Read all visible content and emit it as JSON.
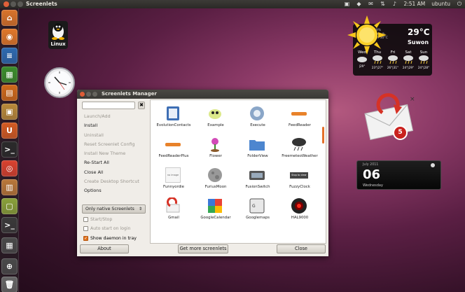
{
  "top_panel": {
    "title": "Screenlets",
    "time": "2:51 AM",
    "user": "ubuntu"
  },
  "desktop": {
    "linux_label": "Linux"
  },
  "launcher": {
    "items": [
      {
        "name": "home-folder-icon",
        "color": "#d9742b"
      },
      {
        "name": "firefox-icon",
        "color": "#e0782a"
      },
      {
        "name": "writer-icon",
        "color": "#2d6ab0"
      },
      {
        "name": "calc-icon",
        "color": "#3b8e2d"
      },
      {
        "name": "impress-icon",
        "color": "#cf6a1b"
      },
      {
        "name": "software-center-icon",
        "color": "#b98a3a"
      },
      {
        "name": "ubuntu-one-icon",
        "color": "#d45c23"
      },
      {
        "name": "terminal-icon",
        "color": "#2a2a2a"
      },
      {
        "name": "chrome-icon",
        "color": "#d9422f"
      },
      {
        "name": "archive-icon",
        "color": "#b9783a"
      },
      {
        "name": "screenlets-icon",
        "color": "#8aa23b"
      },
      {
        "name": "terminal2-icon",
        "color": "#3a3a3a"
      },
      {
        "name": "workspace-icon",
        "color": "#4a4a4a"
      },
      {
        "name": "apps-lens-icon",
        "color": "#4a4a4a"
      },
      {
        "name": "trash-icon",
        "color": "#666666"
      }
    ]
  },
  "manager": {
    "title": "Screenlets Manager",
    "clear_glyph": "✖",
    "menu": [
      {
        "label": "Launch/Add",
        "enabled": false
      },
      {
        "label": "Install",
        "enabled": true
      },
      {
        "label": "Uninstall",
        "enabled": false
      },
      {
        "label": "Reset Screenlet Config",
        "enabled": false
      },
      {
        "label": "Install New Theme",
        "enabled": false
      },
      {
        "label": "Re-Start All",
        "enabled": true
      },
      {
        "label": "Close All",
        "enabled": true
      },
      {
        "label": "Create Desktop Shortcut",
        "enabled": false
      },
      {
        "label": "Options",
        "enabled": true
      }
    ],
    "filter_value": "Only native Screenlets",
    "start_stop_label": "Start/Stop",
    "auto_start_label": "Auto start on login",
    "show_daemon_label": "Show daemon in tray",
    "show_daemon_checked": true,
    "grid_items": [
      "EvolutionContacts",
      "Example",
      "Execute",
      "FeedReader",
      "FeedReaderPlus",
      "Flower",
      "FolderView",
      "FreemeteoWeather",
      "Funnyordie",
      "FuriusMoon",
      "FusionSwitch",
      "FuzzyClock",
      "Gmail",
      "GoogleCalendar",
      "Googlemaps",
      "HAL9000"
    ],
    "funnyordie_thumb_text": "no image",
    "fuzzyclock_thumb_text": "Stop to clear",
    "about_label": "About",
    "more_label": "Get more screenlets",
    "close_label": "Close"
  },
  "weather": {
    "temp": "29°C",
    "city": "Suwon",
    "details": [
      "H 49%",
      "W 5Km/h",
      "W Ch 30°C"
    ],
    "days": [
      {
        "day": "Wed",
        "temps": "|29°"
      },
      {
        "day": "Thu",
        "temps": "23°|27°"
      },
      {
        "day": "Fri",
        "temps": "26°|31°"
      },
      {
        "day": "Sat",
        "temps": "24°|29°"
      },
      {
        "day": "Sun",
        "temps": "24°|28°"
      }
    ]
  },
  "mail": {
    "count": "5"
  },
  "clock_widget": {
    "month": "July 2011",
    "day": "06",
    "weekday": "Wednesday"
  }
}
